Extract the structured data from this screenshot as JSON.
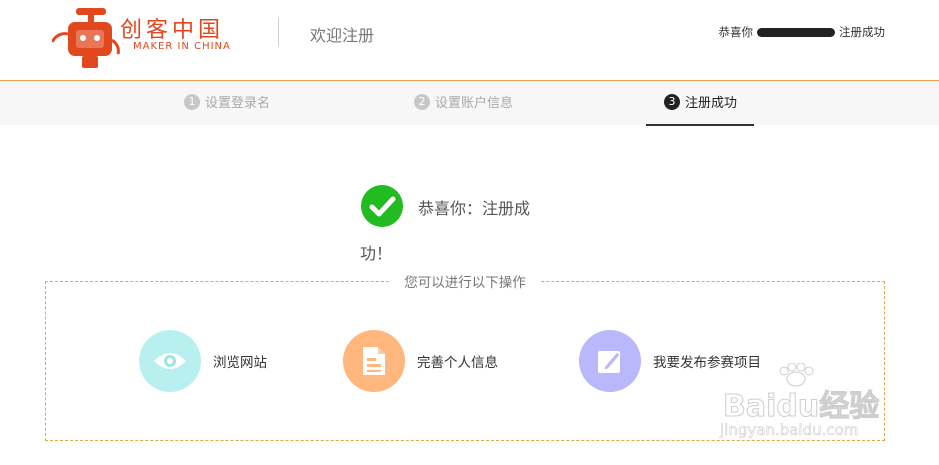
{
  "header": {
    "logo_cn": "创客中国",
    "logo_en": "MAKER IN CHINA",
    "welcome": "欢迎注册",
    "user_prefix": "恭喜你",
    "user_suffix": "注册成功"
  },
  "steps": [
    {
      "num": "1",
      "label": "设置登录名",
      "state": "done"
    },
    {
      "num": "2",
      "label": "设置账户信息",
      "state": "done"
    },
    {
      "num": "3",
      "label": "注册成功",
      "state": "active"
    }
  ],
  "success": {
    "line1": "恭喜你：注册成",
    "line2": "功！"
  },
  "actions": {
    "title": "您可以进行以下操作",
    "items": [
      {
        "label": "浏览网站",
        "icon": "eye-icon",
        "color": "#b8f0f0"
      },
      {
        "label": "完善个人信息",
        "icon": "document-icon",
        "color": "#ffb77e"
      },
      {
        "label": "我要发布参赛项目",
        "icon": "edit-icon",
        "color": "#b8b8fb"
      }
    ]
  },
  "watermark": {
    "brand": "Baidu经验",
    "url": "jingyan.baidu.com"
  },
  "colors": {
    "accent": "#e2481e",
    "success": "#22bb22",
    "header_border": "#f0a050"
  }
}
